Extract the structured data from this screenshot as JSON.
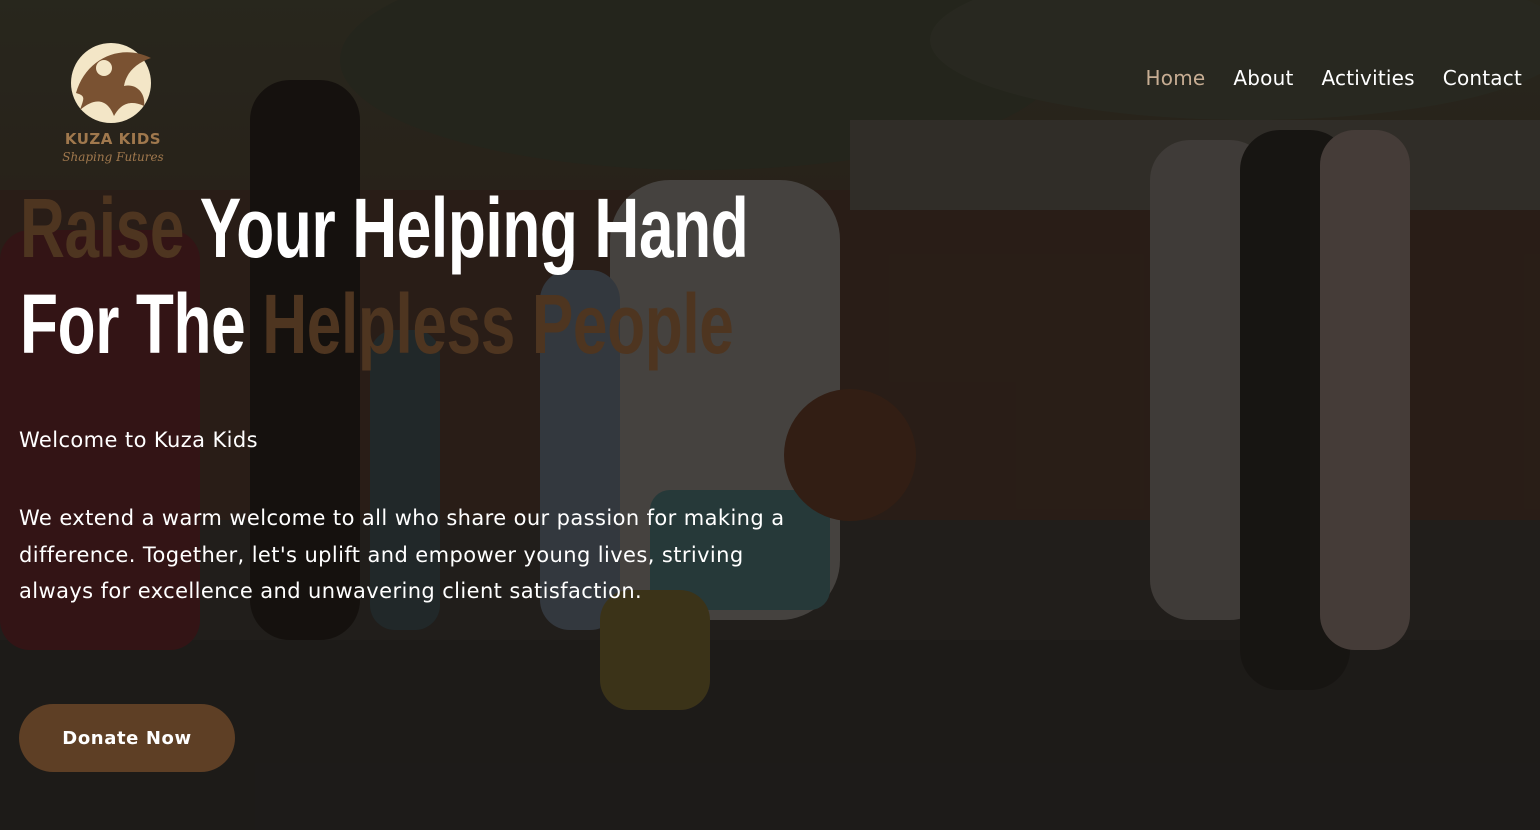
{
  "brand": {
    "name": "KUZA KIDS",
    "tagline": "Shaping Futures"
  },
  "nav": {
    "items": [
      {
        "label": "Home",
        "active": true
      },
      {
        "label": "About",
        "active": false
      },
      {
        "label": "Activities",
        "active": false
      },
      {
        "label": "Contact",
        "active": false
      }
    ]
  },
  "hero": {
    "line1_accent": "Raise",
    "line1_rest": " Your Helping Hand",
    "line2_start": "For The ",
    "line2_accent": "Helpless People",
    "welcome": "Welcome to Kuza Kids",
    "description": "We extend a warm welcome to all who share our passion for making a difference. Together, let's uplift and empower young lives, striving always for excellence and unwavering client satisfaction.",
    "cta_label": "Donate Now"
  },
  "colors": {
    "accent_brown": "#5e3f25",
    "heading_accent": "#4e3520",
    "nav_active": "#c7ad93",
    "text": "#ffffff"
  }
}
